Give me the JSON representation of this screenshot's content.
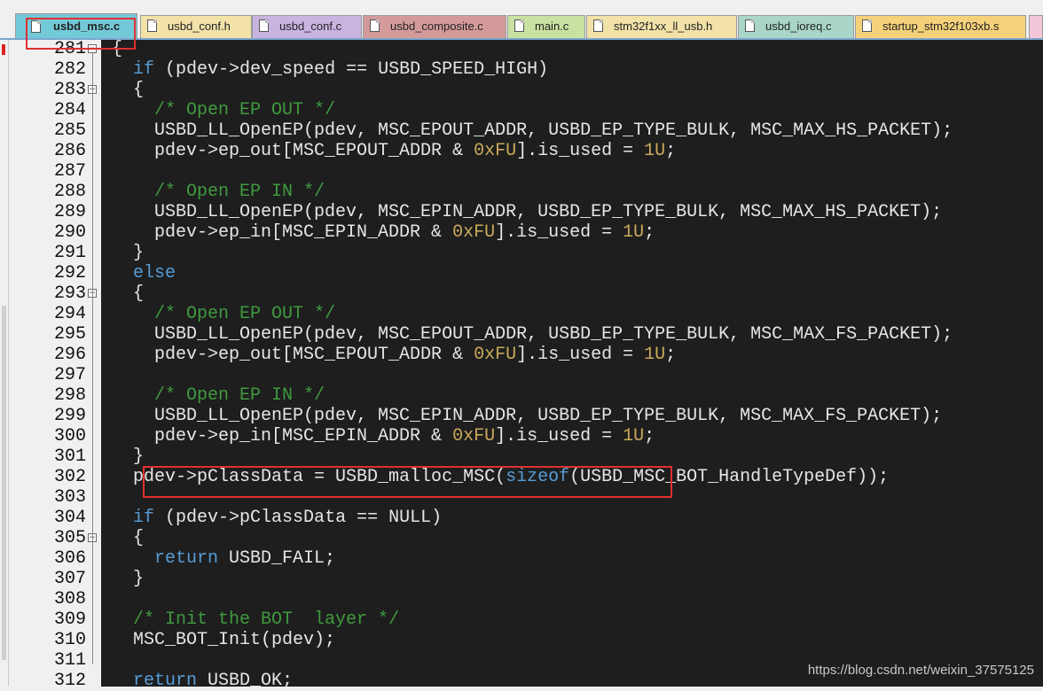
{
  "tabs": [
    {
      "label": "usbd_msc.c",
      "color": "#74c9d8",
      "active": true
    },
    {
      "label": "usbd_conf.h",
      "color": "#f2e2a8"
    },
    {
      "label": "usbd_conf.c",
      "color": "#c9b3e0"
    },
    {
      "label": "usbd_composite.c",
      "color": "#d49a9a"
    },
    {
      "label": "main.c",
      "color": "#c9e2a2"
    },
    {
      "label": "stm32f1xx_ll_usb.h",
      "color": "#f2e2a8"
    },
    {
      "label": "usbd_ioreq.c",
      "color": "#a9d6c9"
    },
    {
      "label": "startup_stm32f103xb.s",
      "color": "#f5d27a"
    }
  ],
  "code_lines": [
    {
      "n": "281",
      "fold": "minus",
      "t": "{"
    },
    {
      "n": "282",
      "t": "  <span class=\"kw\">if</span> (pdev->dev_speed == USBD_SPEED_HIGH)"
    },
    {
      "n": "283",
      "fold": "minus",
      "t": "  {"
    },
    {
      "n": "284",
      "t": "    <span class=\"cm\">/* Open EP OUT */</span>"
    },
    {
      "n": "285",
      "t": "    USBD_LL_OpenEP(pdev, MSC_EPOUT_ADDR, USBD_EP_TYPE_BULK, MSC_MAX_HS_PACKET);"
    },
    {
      "n": "286",
      "t": "    pdev->ep_out[MSC_EPOUT_ADDR & <span class=\"nm\">0xFU</span>].is_used = <span class=\"nm\">1U</span>;"
    },
    {
      "n": "287",
      "t": ""
    },
    {
      "n": "288",
      "t": "    <span class=\"cm\">/* Open EP IN */</span>"
    },
    {
      "n": "289",
      "t": "    USBD_LL_OpenEP(pdev, MSC_EPIN_ADDR, USBD_EP_TYPE_BULK, MSC_MAX_HS_PACKET);"
    },
    {
      "n": "290",
      "t": "    pdev->ep_in[MSC_EPIN_ADDR & <span class=\"nm\">0xFU</span>].is_used = <span class=\"nm\">1U</span>;"
    },
    {
      "n": "291",
      "t": "  }"
    },
    {
      "n": "292",
      "t": "  <span class=\"kw\">else</span>"
    },
    {
      "n": "293",
      "fold": "minus",
      "t": "  {"
    },
    {
      "n": "294",
      "t": "    <span class=\"cm\">/* Open EP OUT */</span>"
    },
    {
      "n": "295",
      "t": "    USBD_LL_OpenEP(pdev, MSC_EPOUT_ADDR, USBD_EP_TYPE_BULK, MSC_MAX_FS_PACKET);"
    },
    {
      "n": "296",
      "t": "    pdev->ep_out[MSC_EPOUT_ADDR & <span class=\"nm\">0xFU</span>].is_used = <span class=\"nm\">1U</span>;"
    },
    {
      "n": "297",
      "t": ""
    },
    {
      "n": "298",
      "t": "    <span class=\"cm\">/* Open EP IN */</span>"
    },
    {
      "n": "299",
      "t": "    USBD_LL_OpenEP(pdev, MSC_EPIN_ADDR, USBD_EP_TYPE_BULK, MSC_MAX_FS_PACKET);"
    },
    {
      "n": "300",
      "t": "    pdev->ep_in[MSC_EPIN_ADDR & <span class=\"nm\">0xFU</span>].is_used = <span class=\"nm\">1U</span>;"
    },
    {
      "n": "301",
      "t": "  }"
    },
    {
      "n": "302",
      "t": "  pdev->pClassData = USBD_malloc_MSC(<span class=\"kw\">sizeof</span>(USBD_MSC_BOT_HandleTypeDef));"
    },
    {
      "n": "303",
      "t": ""
    },
    {
      "n": "304",
      "t": "  <span class=\"kw\">if</span> (pdev->pClassData == NULL)"
    },
    {
      "n": "305",
      "fold": "minus",
      "t": "  {"
    },
    {
      "n": "306",
      "t": "    <span class=\"kw\">return</span> USBD_FAIL;"
    },
    {
      "n": "307",
      "t": "  }"
    },
    {
      "n": "308",
      "t": ""
    },
    {
      "n": "309",
      "t": "  <span class=\"cm\">/* Init the BOT  layer */</span>"
    },
    {
      "n": "310",
      "t": "  MSC_BOT_Init(pdev);"
    },
    {
      "n": "311",
      "t": ""
    },
    {
      "n": "312",
      "t": "  <span class=\"kw\">return</span> USBD_OK;"
    }
  ],
  "watermark": "https://blog.csdn.net/weixin_37575125",
  "highlight_color": "#e03030"
}
